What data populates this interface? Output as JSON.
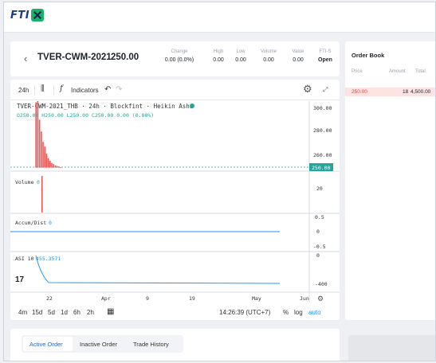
{
  "app": {
    "logo_text": "FTI"
  },
  "ticker": {
    "back_icon": "chevron-left-icon",
    "symbol": "TVER-CWM-2021",
    "last_price": "250.00",
    "stats": [
      {
        "label": "Change",
        "value": "0.00 (0.0%)"
      },
      {
        "label": "High",
        "value": "0.00"
      },
      {
        "label": "Low",
        "value": "0.00"
      },
      {
        "label": "Volume",
        "value": "0.00"
      },
      {
        "label": "Value",
        "value": "0.00"
      },
      {
        "label": "FTI-S",
        "value": "Open"
      }
    ]
  },
  "chart_toolbar": {
    "interval": "24h",
    "indicators_label": "Indicators",
    "undo_icon": "undo-icon",
    "redo_icon": "redo-icon",
    "settings_icon": "gear-icon",
    "fullscreen_icon": "expand-icon"
  },
  "chart_data": {
    "type": "candlestick",
    "title": "TVER-CWM-2021_THB · 24h · Blockfint · Heikin Ashi",
    "ohlc_text": "O250.00 H250.00 L250.00 C250.00 0.00 (0.00%)",
    "price_axis": [
      "300.00",
      "280.00",
      "260.00"
    ],
    "last_price_label": "250.00",
    "ylim": [
      247,
      307
    ],
    "spike_x": [
      1.0,
      1.5,
      2.0,
      2.5,
      3.0,
      3.5,
      4.0,
      4.5,
      5.0,
      5.5,
      6.0,
      6.5,
      7.0,
      7.5,
      8.0
    ],
    "spike_high": [
      306,
      307,
      291,
      281,
      272,
      268,
      262,
      258,
      256,
      254,
      253,
      252,
      251.5,
      251,
      250.5
    ],
    "x_ticks": [
      "22",
      "Apr",
      "9",
      "19",
      "May",
      "Jun"
    ],
    "panes": [
      {
        "name": "Volume",
        "value": "0",
        "axis": [
          "20"
        ]
      },
      {
        "name": "Accum/Dist",
        "value": "0",
        "axis": [
          "0.5",
          "0",
          "-0.5"
        ]
      },
      {
        "name": "ASI 10",
        "value": "455.3571",
        "axis": [
          "0",
          "-400"
        ]
      }
    ]
  },
  "chart_bottom": {
    "ranges": [
      "4m",
      "15d",
      "5d",
      "1d",
      "6h",
      "2h"
    ],
    "calendar_icon": "calendar-icon",
    "time": "14:26:39 (UTC+7)",
    "percent": "%",
    "log": "log",
    "auto": "auto"
  },
  "order_book": {
    "title": "Order Book",
    "headers": [
      "Price",
      "Amount",
      "Total"
    ],
    "rows": [
      {
        "price": "250.00",
        "amount": "18",
        "total": "4,500.00"
      }
    ]
  },
  "order_tabs": [
    "Active Order",
    "Inactive Order",
    "Trade History"
  ],
  "colors": {
    "accent": "#2168d8",
    "up": "#26a69a",
    "down": "#ef5350",
    "brand_green": "#17b26a"
  }
}
